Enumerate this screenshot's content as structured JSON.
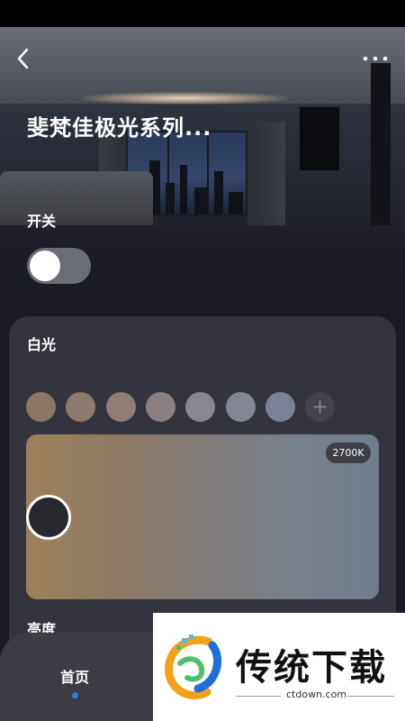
{
  "header": {
    "title": "斐梵佳极光系列...",
    "back_icon": "chevron-left-icon",
    "more_icon": "more-dots-icon"
  },
  "power": {
    "label": "开关",
    "toggle_on": false
  },
  "white_light": {
    "title": "白光",
    "presets": [
      "#8a7768",
      "#8d7a6e",
      "#8e7e76",
      "#8a8081",
      "#87878f",
      "#828791",
      "#7b8296"
    ],
    "add_icon": "plus-icon",
    "temperature_label": "2700K",
    "handle_level": 0.0
  },
  "brightness": {
    "label": "亮度"
  },
  "bottom_nav": {
    "home_label": "首页",
    "active_color": "#2f7fe0"
  },
  "watermark": {
    "title": "传统下载",
    "domain": "ctdown.com"
  },
  "colors": {
    "background": "#1a1b24",
    "card": "#33343d",
    "toggle_off": "#6b6d74"
  }
}
